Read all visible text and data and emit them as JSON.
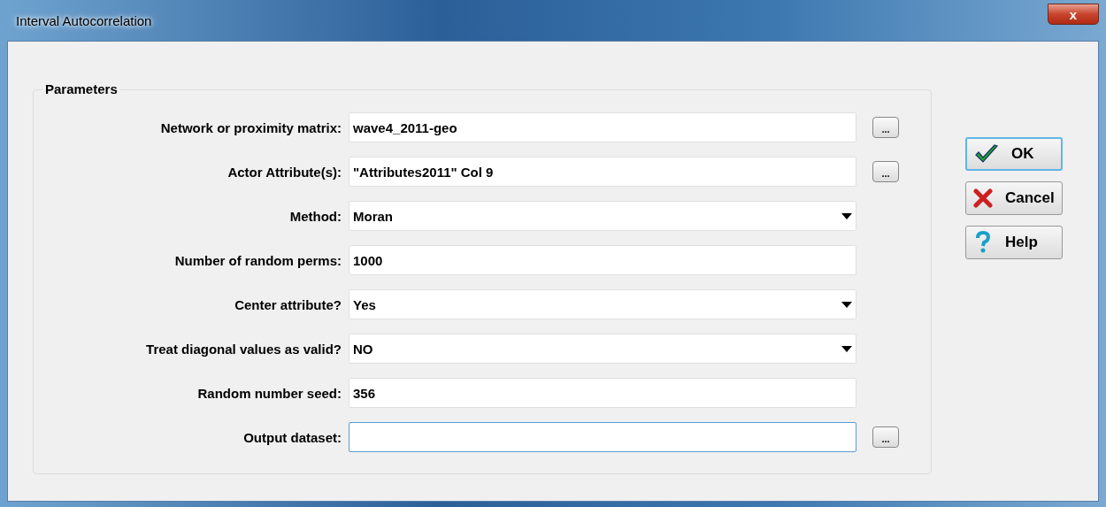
{
  "window": {
    "title": "Interval Autocorrelation",
    "close": "x"
  },
  "group": {
    "title": "Parameters",
    "rows": [
      {
        "label": "Network or proximity matrix:",
        "kind": "text",
        "value": "wave4_2011-geo",
        "browse": "...",
        "focused": false
      },
      {
        "label": "Actor Attribute(s):",
        "kind": "text",
        "value": "\"Attributes2011\" Col 9",
        "browse": "...",
        "focused": false
      },
      {
        "label": "Method:",
        "kind": "dropdown",
        "value": "Moran",
        "focused": false
      },
      {
        "label": "Number of random perms:",
        "kind": "text",
        "value": "1000",
        "focused": false
      },
      {
        "label": "Center attribute?",
        "kind": "dropdown",
        "value": "Yes",
        "focused": false
      },
      {
        "label": "Treat diagonal values as valid?",
        "kind": "dropdown",
        "value": "NO",
        "focused": false
      },
      {
        "label": "Random number seed:",
        "kind": "text",
        "value": "356",
        "focused": false
      },
      {
        "label": "Output dataset:",
        "kind": "text",
        "browse": "...",
        "focused": true
      }
    ]
  },
  "buttons": [
    {
      "label": "OK",
      "kind": "ok",
      "default": true
    },
    {
      "label": "Cancel",
      "kind": "cancel",
      "default": false
    },
    {
      "label": "Help",
      "kind": "help",
      "default": false
    }
  ]
}
